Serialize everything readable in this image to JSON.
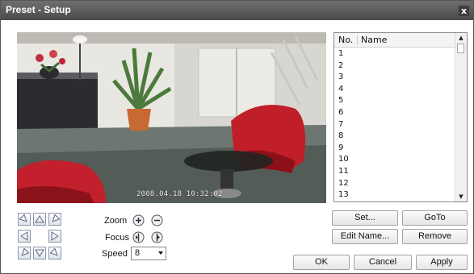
{
  "window": {
    "title": "Preset - Setup",
    "close_glyph": "x"
  },
  "video": {
    "timestamp": "2008.04.18 10:32:02"
  },
  "preset_list": {
    "col_no": "No.",
    "col_name": "Name",
    "rows": [
      "1",
      "2",
      "3",
      "4",
      "5",
      "6",
      "7",
      "8",
      "9",
      "10",
      "11",
      "12",
      "13"
    ]
  },
  "ptz": {
    "zoom_label": "Zoom",
    "focus_label": "Focus",
    "speed_label": "Speed",
    "speed_value": "8"
  },
  "actions": {
    "set": "Set...",
    "goto": "GoTo",
    "edit_name": "Edit Name...",
    "remove": "Remove"
  },
  "dialog": {
    "ok": "OK",
    "cancel": "Cancel",
    "apply": "Apply"
  }
}
